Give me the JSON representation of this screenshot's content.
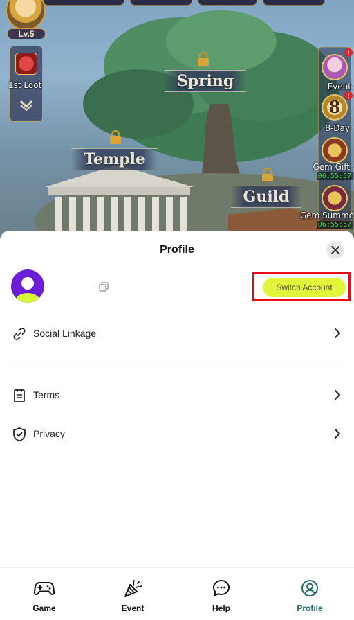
{
  "game": {
    "level": "Lv.5",
    "left_item_label": "1st Loot",
    "locations": [
      "Spring",
      "Temple",
      "Guild"
    ],
    "right_items": [
      {
        "label": "Event",
        "badge": "!"
      },
      {
        "label": "8-Day",
        "badge": "!",
        "number": "8"
      },
      {
        "label": "Gem Gift",
        "timer": "06:55:57"
      },
      {
        "label": "Gem Summo",
        "timer": "06:55:57"
      }
    ]
  },
  "profile": {
    "title": "Profile",
    "switch_account_label": "Switch Account",
    "items": {
      "social_linkage": "Social Linkage",
      "terms": "Terms",
      "privacy": "Privacy"
    }
  },
  "nav": {
    "game": "Game",
    "event": "Event",
    "help": "Help",
    "profile": "Profile",
    "active": "profile"
  },
  "colors": {
    "switch_button": "#e2f53a",
    "highlight_box": "#ec0a16",
    "avatar": "#6a1ed6",
    "avatar_body": "#d8f53a",
    "nav_active": "#1a6a63"
  }
}
